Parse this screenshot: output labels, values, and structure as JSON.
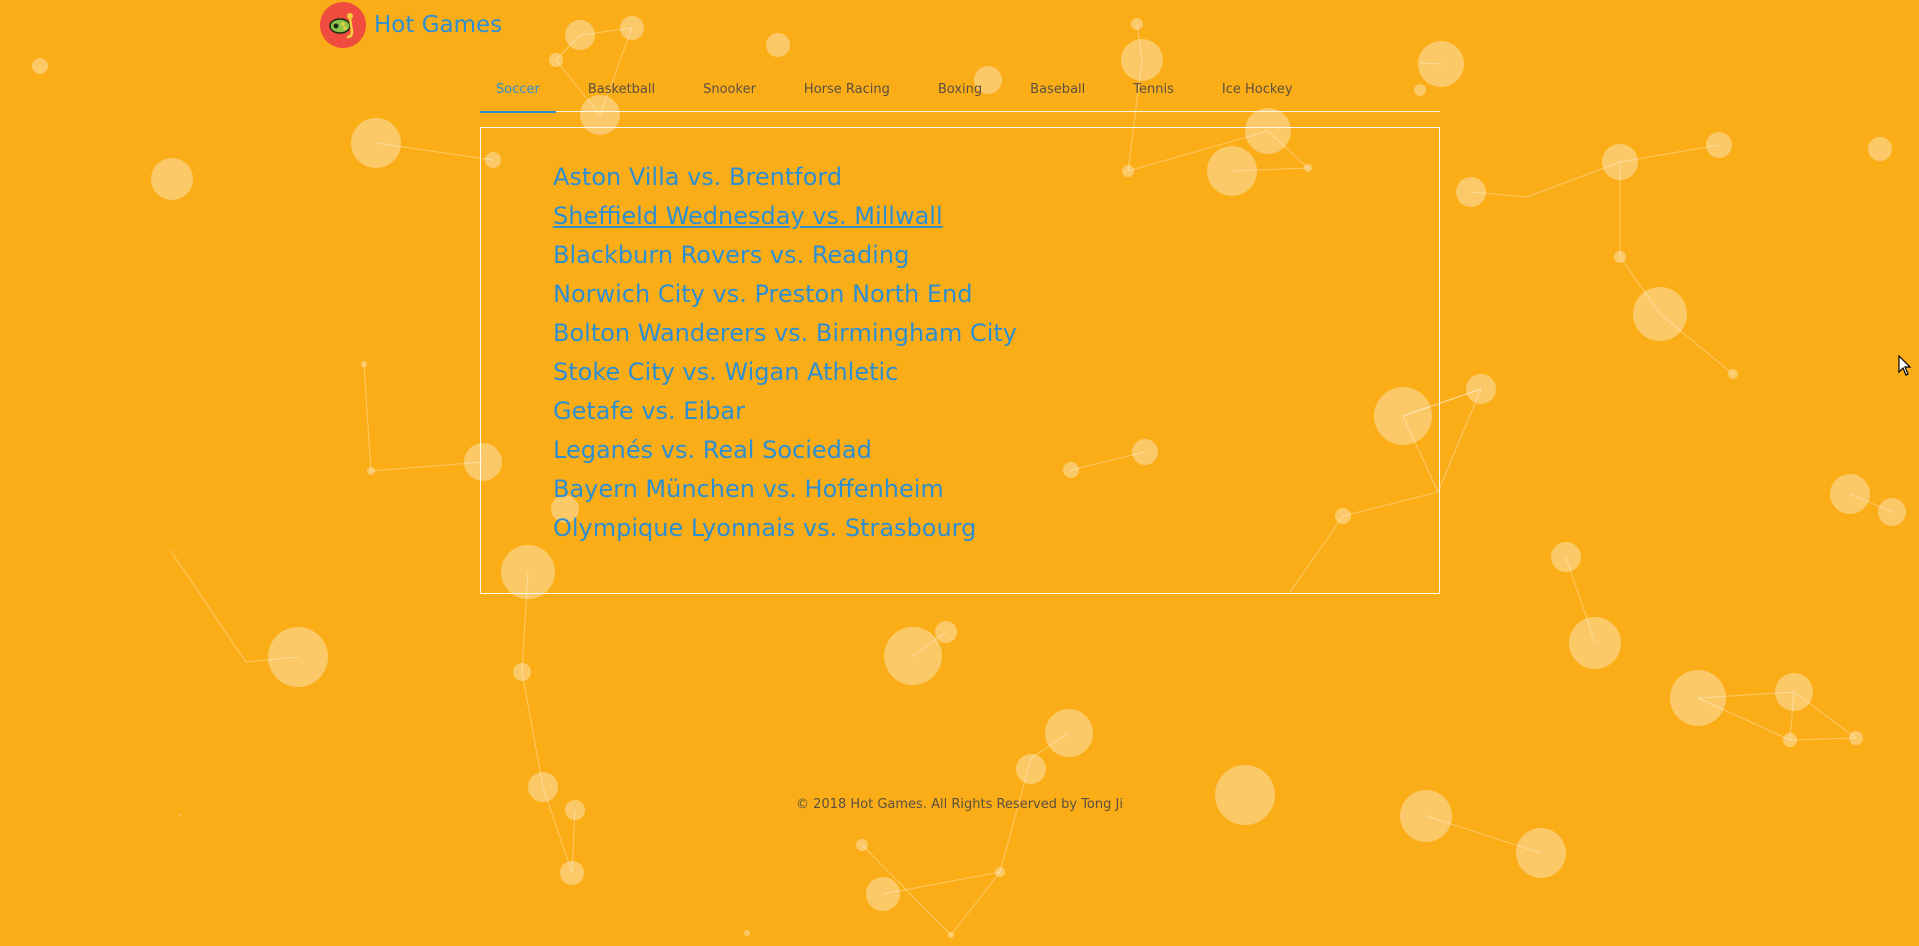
{
  "header": {
    "brand": "Hot Games",
    "logo_icon": "joystick-icon"
  },
  "tabs": [
    {
      "label": "Soccer",
      "active": true
    },
    {
      "label": "Basketball",
      "active": false
    },
    {
      "label": "Snooker",
      "active": false
    },
    {
      "label": "Horse Racing",
      "active": false
    },
    {
      "label": "Boxing",
      "active": false
    },
    {
      "label": "Baseball",
      "active": false
    },
    {
      "label": "Tennis",
      "active": false
    },
    {
      "label": "Ice Hockey",
      "active": false
    }
  ],
  "matches": [
    "Aston Villa vs. Brentford",
    "Sheffield Wednesday vs. Millwall",
    "Blackburn Rovers vs. Reading",
    "Norwich City vs. Preston North End",
    "Bolton Wanderers vs. Birmingham City",
    "Stoke City vs. Wigan Athletic",
    "Getafe vs. Eibar",
    "Leganés vs. Real Sociedad",
    "Bayern München vs. Hoffenheim",
    "Olympique Lyonnais vs. Strasbourg"
  ],
  "hovered_match": 1,
  "footer": {
    "copyright": "© 2018 Hot Games. All Rights Reserved by Tong Ji"
  },
  "colors": {
    "background": "#FBAD18",
    "accent": "#2E8FD0",
    "logo_bg": "#EF4B3E"
  }
}
